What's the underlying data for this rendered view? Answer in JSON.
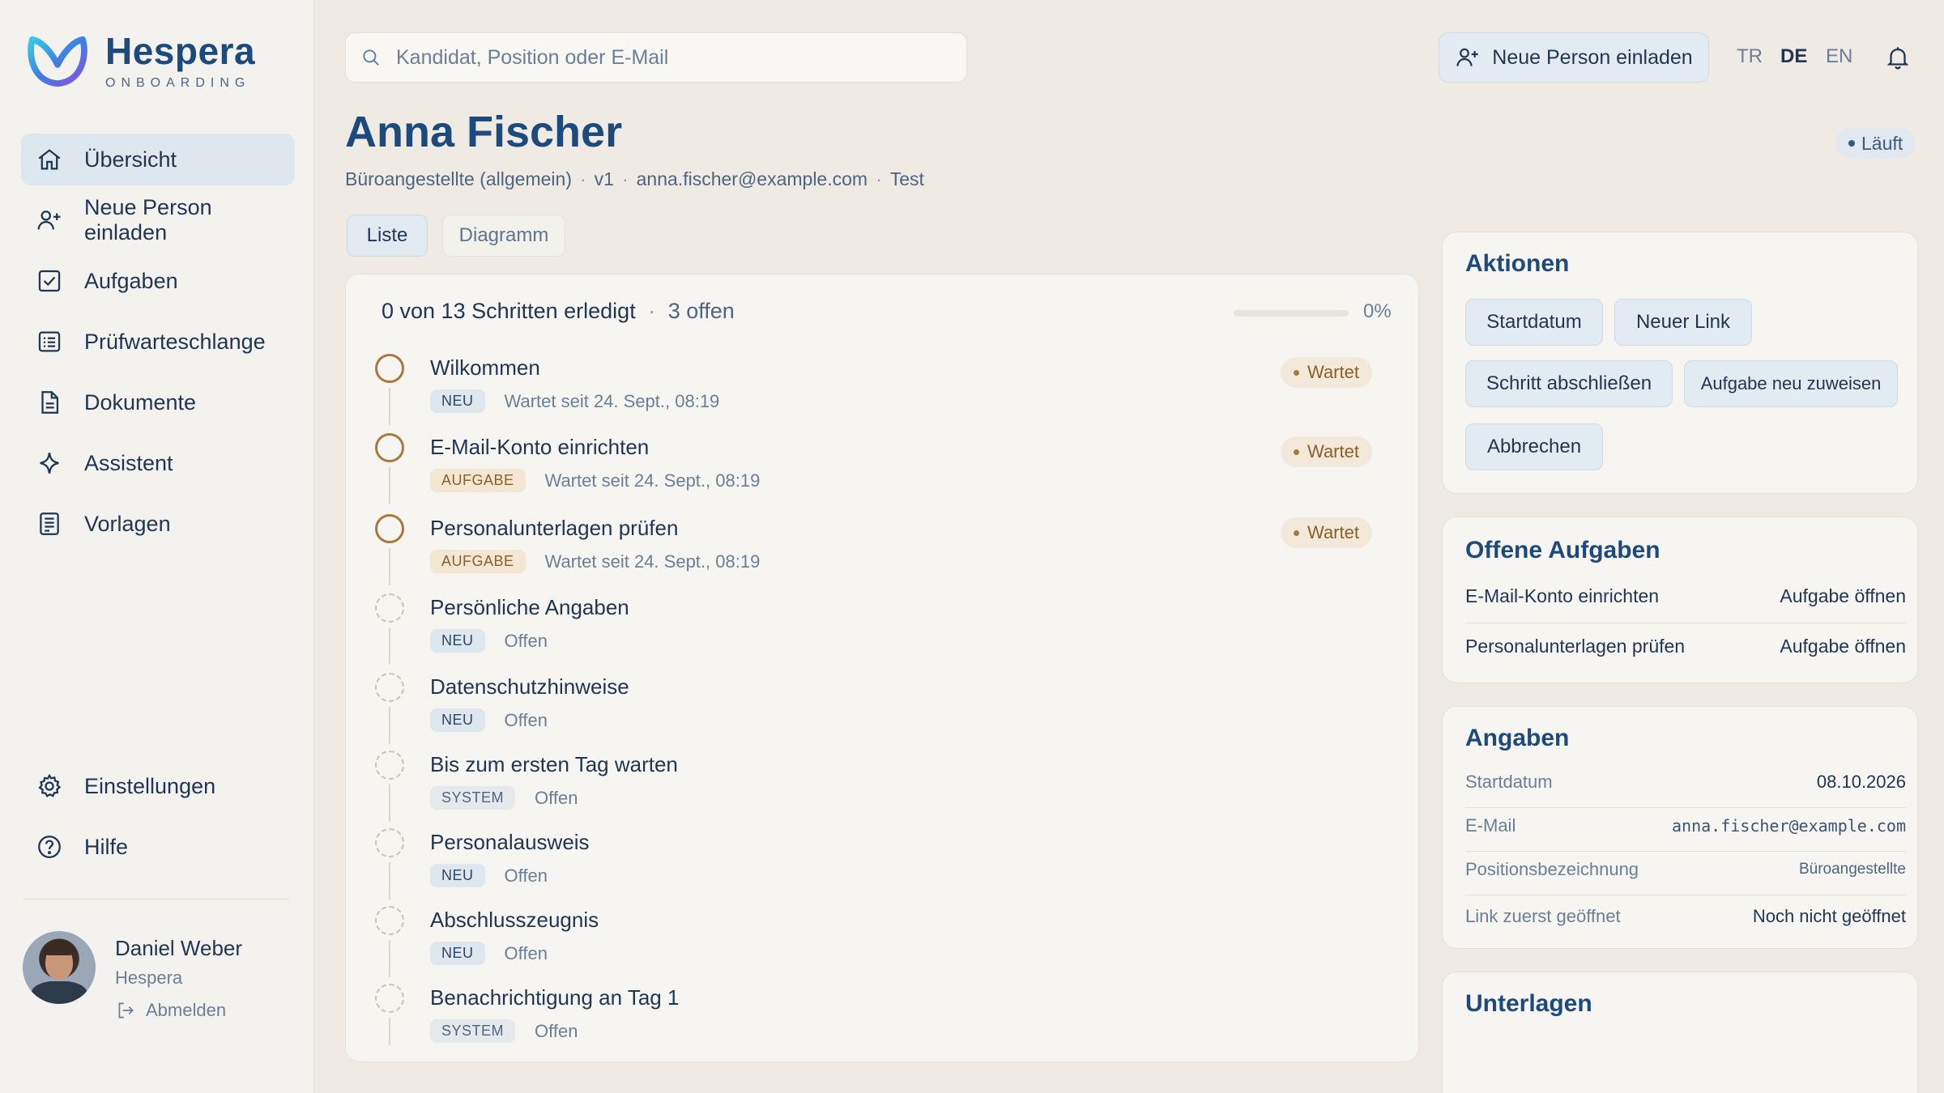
{
  "brand": {
    "name": "Hespera",
    "subtitle": "ONBOARDING"
  },
  "sidebar": {
    "items": [
      {
        "label": "Übersicht",
        "icon": "home-icon",
        "active": true
      },
      {
        "label": "Neue Person einladen",
        "icon": "user-plus-icon"
      },
      {
        "label": "Aufgaben",
        "icon": "checkbox-icon"
      },
      {
        "label": "Prüfwarteschlange",
        "icon": "list-icon"
      },
      {
        "label": "Dokumente",
        "icon": "document-icon"
      },
      {
        "label": "Assistent",
        "icon": "sparkle-icon"
      },
      {
        "label": "Vorlagen",
        "icon": "template-icon"
      }
    ],
    "bottom_items": [
      {
        "label": "Einstellungen",
        "icon": "gear-icon"
      },
      {
        "label": "Hilfe",
        "icon": "help-icon"
      }
    ]
  },
  "user": {
    "name": "Daniel Weber",
    "org": "Hespera",
    "logout_label": "Abmelden"
  },
  "topbar": {
    "search_placeholder": "Kandidat, Position oder E-Mail",
    "invite_label": "Neue Person einladen",
    "languages": [
      "TR",
      "DE",
      "EN"
    ],
    "active_language": "DE"
  },
  "header": {
    "name": "Anna Fischer",
    "position": "Büroangestellte (allgemein)",
    "version": "v1",
    "email": "anna.fischer@example.com",
    "env": "Test",
    "status": "Läuft",
    "sep": "·"
  },
  "tabs": {
    "list": "Liste",
    "diagram": "Diagramm"
  },
  "progress": {
    "summary": "0 von 13 Schritten erledigt",
    "open": "3 offen",
    "percent_label": "0%",
    "percent": 0
  },
  "steps": [
    {
      "title": "Wilkommen",
      "tag": "NEU",
      "tag_type": "neu",
      "status": "Wartet seit 24. Sept., 08:19",
      "state": "waiting",
      "badge": "Wartet"
    },
    {
      "title": "E-Mail-Konto einrichten",
      "tag": "AUFGABE",
      "tag_type": "aufgabe",
      "status": "Wartet seit 24. Sept., 08:19",
      "state": "waiting",
      "badge": "Wartet"
    },
    {
      "title": "Personalunterlagen prüfen",
      "tag": "AUFGABE",
      "tag_type": "aufgabe",
      "status": "Wartet seit 24. Sept., 08:19",
      "state": "waiting",
      "badge": "Wartet"
    },
    {
      "title": "Persönliche Angaben",
      "tag": "NEU",
      "tag_type": "neu",
      "status": "Offen",
      "state": "pending"
    },
    {
      "title": "Datenschutzhinweise",
      "tag": "NEU",
      "tag_type": "neu",
      "status": "Offen",
      "state": "pending"
    },
    {
      "title": "Bis zum ersten Tag warten",
      "tag": "SYSTEM",
      "tag_type": "system",
      "status": "Offen",
      "state": "pending"
    },
    {
      "title": "Personalausweis",
      "tag": "NEU",
      "tag_type": "neu",
      "status": "Offen",
      "state": "pending"
    },
    {
      "title": "Abschlusszeugnis",
      "tag": "NEU",
      "tag_type": "neu",
      "status": "Offen",
      "state": "pending"
    },
    {
      "title": "Benachrichtigung an Tag 1",
      "tag": "SYSTEM",
      "tag_type": "system",
      "status": "Offen",
      "state": "pending"
    }
  ],
  "actions": {
    "title": "Aktionen",
    "buttons": [
      "Startdatum",
      "Neuer Link",
      "Schritt abschließen",
      "Aufgabe neu zuweisen",
      "Abbrechen"
    ]
  },
  "open_tasks": {
    "title": "Offene Aufgaben",
    "items": [
      {
        "label": "E-Mail-Konto einrichten",
        "link": "Aufgabe öffnen"
      },
      {
        "label": "Personalunterlagen prüfen",
        "link": "Aufgabe öffnen"
      }
    ]
  },
  "details": {
    "title": "Angaben",
    "rows": [
      {
        "key": "Startdatum",
        "value": "08.10.2026"
      },
      {
        "key": "E-Mail",
        "value": "anna.fischer@example.com"
      },
      {
        "key": "Positionsbezeichnung",
        "value": "Büroangestellte"
      },
      {
        "key": "Link zuerst geöffnet",
        "value": "Noch nicht geöffnet"
      }
    ]
  },
  "documents": {
    "title": "Unterlagen"
  },
  "colors": {
    "accent": "#1d4a7c",
    "waiting": "#a77a3c",
    "background": "#efebe4"
  }
}
